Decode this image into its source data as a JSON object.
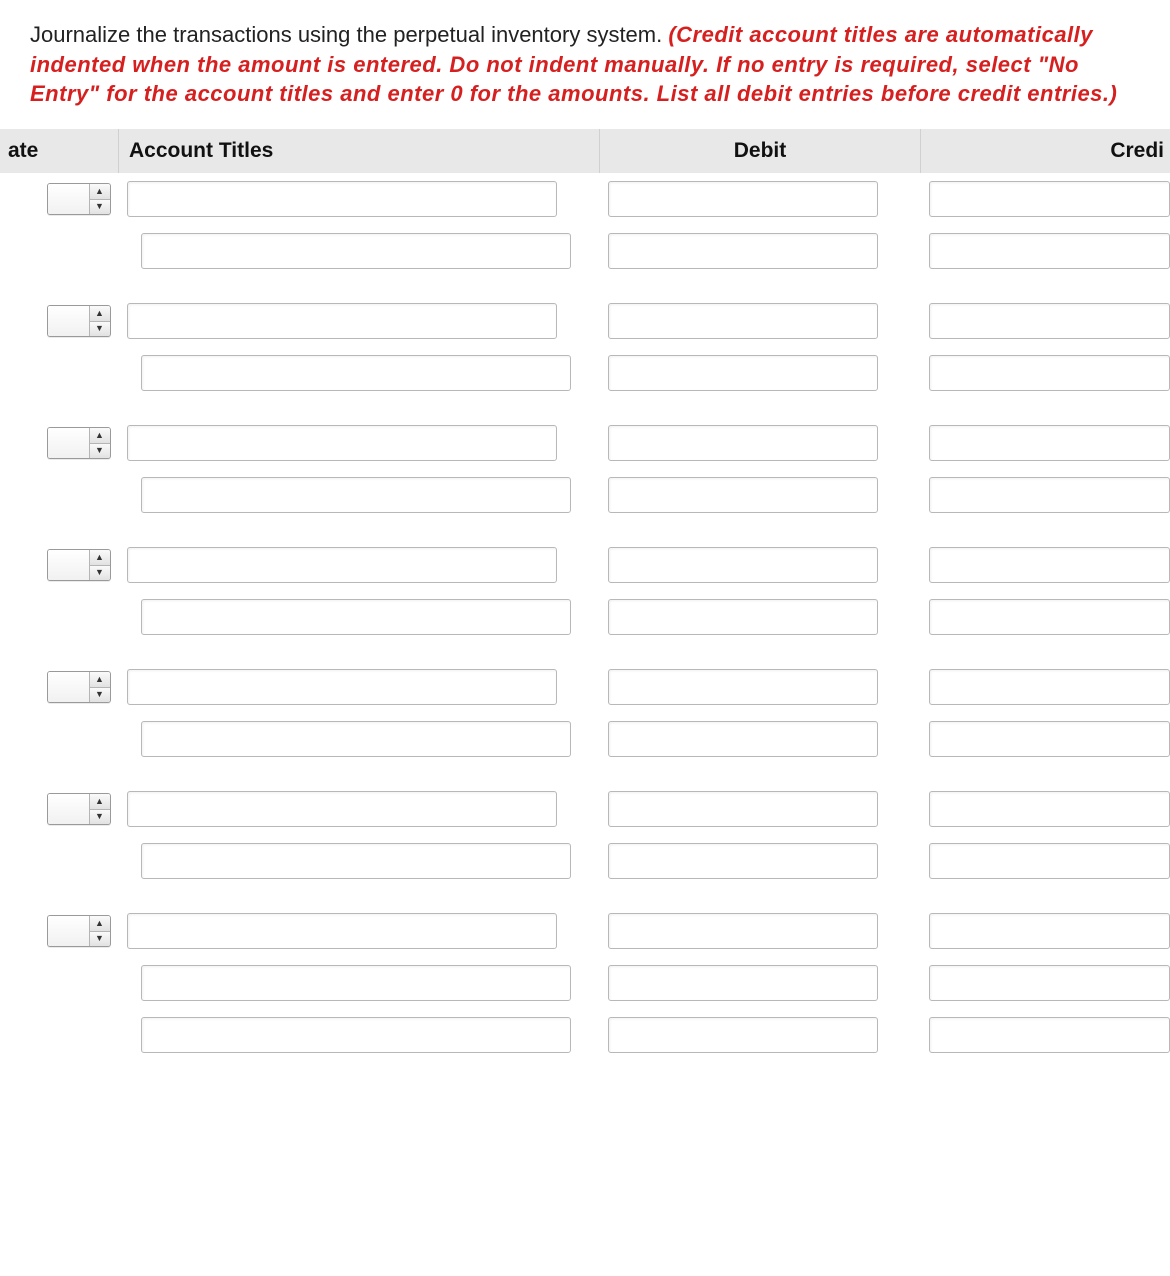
{
  "instructions": {
    "lead": "Journalize the transactions using the perpetual inventory system. ",
    "hint": "(Credit account titles are automatically indented when the amount is entered. Do not indent manually. If no entry is required, select \"No Entry\" for the account titles and enter 0 for the amounts. List all debit entries before credit entries.)"
  },
  "headers": {
    "date": "ate",
    "account": "Account Titles",
    "debit": "Debit",
    "credit": "Credi"
  },
  "groups": [
    {
      "date": "",
      "lines": [
        {
          "acct": "",
          "debit": "",
          "credit": ""
        },
        {
          "acct": "",
          "debit": "",
          "credit": ""
        }
      ]
    },
    {
      "date": "",
      "lines": [
        {
          "acct": "",
          "debit": "",
          "credit": ""
        },
        {
          "acct": "",
          "debit": "",
          "credit": ""
        }
      ]
    },
    {
      "date": "",
      "lines": [
        {
          "acct": "",
          "debit": "",
          "credit": ""
        },
        {
          "acct": "",
          "debit": "",
          "credit": ""
        }
      ]
    },
    {
      "date": "",
      "lines": [
        {
          "acct": "",
          "debit": "",
          "credit": ""
        },
        {
          "acct": "",
          "debit": "",
          "credit": ""
        }
      ]
    },
    {
      "date": "",
      "lines": [
        {
          "acct": "",
          "debit": "",
          "credit": ""
        },
        {
          "acct": "",
          "debit": "",
          "credit": ""
        }
      ]
    },
    {
      "date": "",
      "lines": [
        {
          "acct": "",
          "debit": "",
          "credit": ""
        },
        {
          "acct": "",
          "debit": "",
          "credit": ""
        }
      ]
    },
    {
      "date": "",
      "lines": [
        {
          "acct": "",
          "debit": "",
          "credit": ""
        },
        {
          "acct": "",
          "debit": "",
          "credit": ""
        },
        {
          "acct": "",
          "debit": "",
          "credit": ""
        }
      ]
    }
  ]
}
